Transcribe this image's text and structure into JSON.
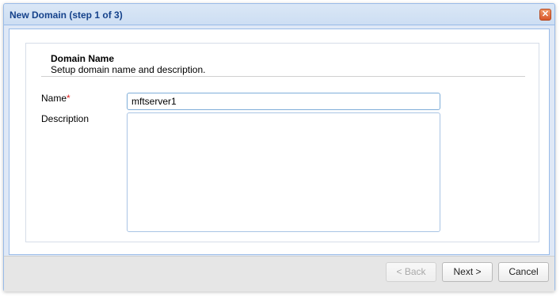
{
  "window": {
    "title": "New Domain (step 1 of 3)",
    "close_glyph": "✕"
  },
  "section": {
    "title": "Domain Name",
    "subtitle": "Setup domain name and description."
  },
  "form": {
    "name_label": "Name",
    "required_marker": "*",
    "name_value": "mftserver1",
    "description_label": "Description",
    "description_value": ""
  },
  "footer": {
    "back_label": "< Back",
    "next_label": "Next >",
    "cancel_label": "Cancel"
  },
  "colors": {
    "title_text": "#15428b",
    "window_border": "#99bbe8",
    "close_button": "#d8572b",
    "required": "#e02020"
  }
}
